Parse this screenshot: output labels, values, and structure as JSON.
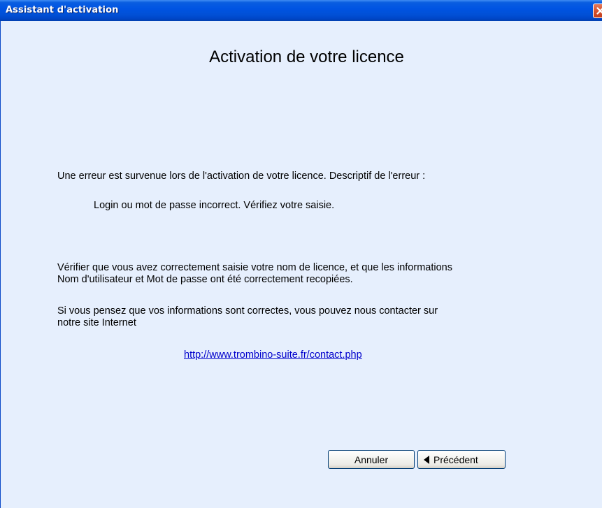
{
  "window": {
    "title": "Assistant d'activation"
  },
  "page": {
    "title": "Activation de votre licence",
    "error_intro": "Une erreur est survenue lors de l'activation de votre licence. Descriptif de l'erreur :",
    "error_detail": "Login ou mot de passe incorrect. Vérifiez votre saisie.",
    "check_line1": "Vérifier que vous avez correctement saisie votre nom de licence, et que les informations",
    "check_line2": "Nom d'utilisateur et Mot de passe ont été correctement recopiées.",
    "contact_line1": "Si vous pensez que vos informations sont correctes, vous pouvez nous contacter sur",
    "contact_line2": "notre site Internet",
    "contact_link": "http://www.trombino-suite.fr/contact.php"
  },
  "buttons": {
    "cancel_label": "Annuler",
    "previous_label": "Précédent"
  },
  "icons": {
    "close": "close-icon",
    "previous": "left-arrow-icon"
  },
  "colors": {
    "titlebar": "#0054e3",
    "client_background": "#e6effd",
    "link": "#0000cc",
    "close_button": "#d7532f"
  }
}
